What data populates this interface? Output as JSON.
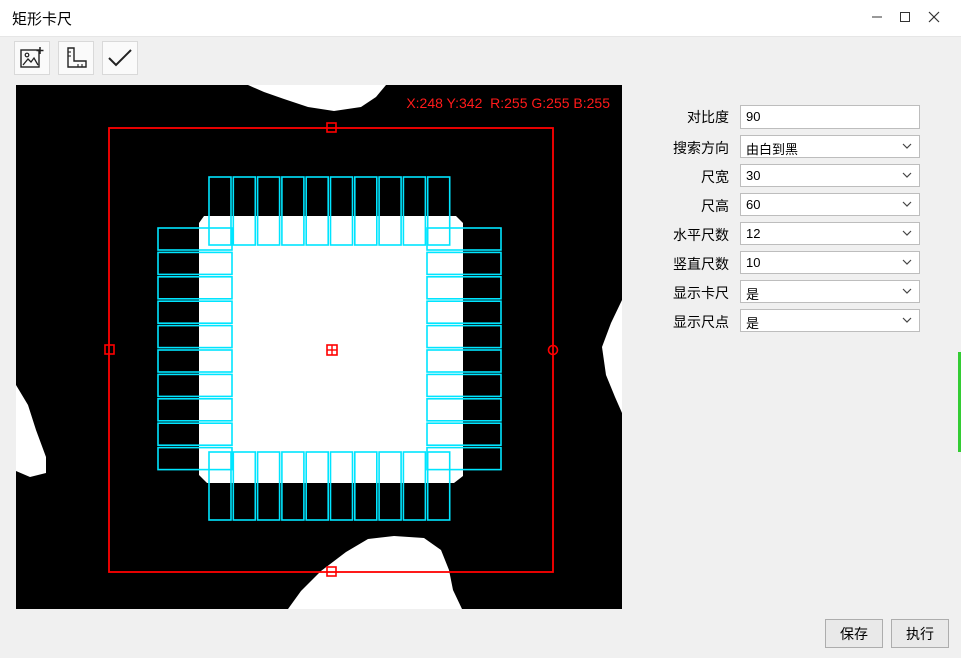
{
  "window": {
    "title": "矩形卡尺",
    "controls": {
      "minimize": "—",
      "maximize": "□",
      "close": "✕"
    }
  },
  "toolbar": [
    {
      "name": "load-image-icon"
    },
    {
      "name": "ruler-icon"
    },
    {
      "name": "checkmark-icon"
    }
  ],
  "viewer": {
    "pixel_readout": "X:248 Y:342  R:255 G:255 B:255",
    "colors": {
      "roi": "#ff0000",
      "caliper": "#00e5ff",
      "background": "#000000",
      "object": "#ffffff"
    }
  },
  "params": {
    "contrast": {
      "label": "对比度",
      "value": "90"
    },
    "direction": {
      "label": "搜索方向",
      "value": "由白到黑"
    },
    "caliper_width": {
      "label": "尺宽",
      "value": "30"
    },
    "caliper_height": {
      "label": "尺高",
      "value": "60"
    },
    "horizontal_count": {
      "label": "水平尺数",
      "value": "12"
    },
    "vertical_count": {
      "label": "竖直尺数",
      "value": "10"
    },
    "show_calipers": {
      "label": "显示卡尺",
      "value": "是"
    },
    "show_points": {
      "label": "显示尺点",
      "value": "是"
    }
  },
  "actions": {
    "save": "保存",
    "execute": "执行"
  }
}
